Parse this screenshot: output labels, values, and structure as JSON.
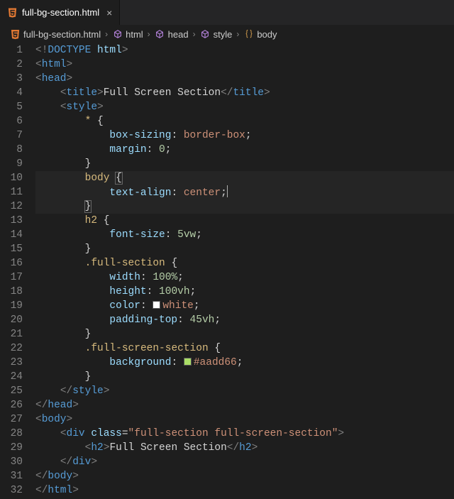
{
  "tab": {
    "filename": "full-bg-section.html"
  },
  "breadcrumbs": [
    {
      "icon": "html-file",
      "label": "full-bg-section.html"
    },
    {
      "icon": "symbol",
      "label": "html"
    },
    {
      "icon": "symbol",
      "label": "head"
    },
    {
      "icon": "symbol",
      "label": "style"
    },
    {
      "icon": "selector",
      "label": "body"
    }
  ],
  "code": {
    "l1_doctype": "DOCTYPE",
    "l1_html": "html",
    "l2_tag": "html",
    "l3_tag": "head",
    "l4_tag": "title",
    "l4_text": "Full Screen Section",
    "l5_tag": "style",
    "l6_sel": "*",
    "l7_prop": "box-sizing",
    "l7_val": "border-box",
    "l8_prop": "margin",
    "l8_val": "0",
    "l10_sel": "body",
    "l11_prop": "text-align",
    "l11_val": "center",
    "l13_sel": "h2",
    "l14_prop": "font-size",
    "l14_val": "5vw",
    "l16_sel": ".full-section",
    "l17_prop": "width",
    "l17_val": "100%",
    "l18_prop": "height",
    "l18_val": "100vh",
    "l19_prop": "color",
    "l19_val": "white",
    "l19_swatch": "#ffffff",
    "l20_prop": "padding-top",
    "l20_val": "45vh",
    "l22_sel": ".full-screen-section",
    "l23_prop": "background",
    "l23_val": "#aadd66",
    "l23_swatch": "#aadd66",
    "l25_tag": "style",
    "l26_tag": "head",
    "l27_tag": "body",
    "l28_tag": "div",
    "l28_attr": "class",
    "l28_str": "full-section full-screen-section",
    "l29_tag": "h2",
    "l29_text": "Full Screen Section",
    "l30_tag": "div",
    "l31_tag": "body",
    "l32_tag": "html"
  },
  "line_count": 32
}
